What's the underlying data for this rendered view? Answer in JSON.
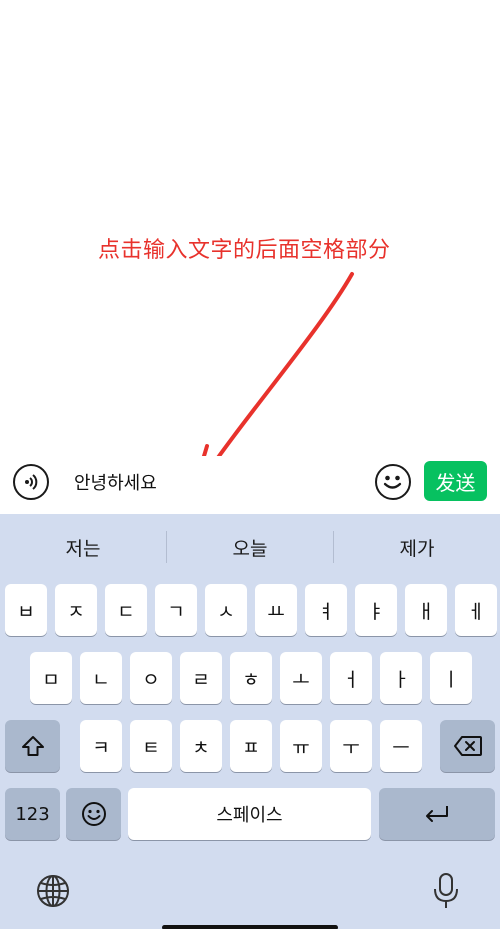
{
  "annotation": {
    "text": "点击输入文字的后面空格部分",
    "color": "#e8322c"
  },
  "input_bar": {
    "voice_icon": "voice-icon",
    "text_value": "안녕하세요",
    "emoji_icon": "emoji-icon",
    "send_label": "发送",
    "send_color": "#07c160"
  },
  "keyboard": {
    "suggestions": [
      "저는",
      "오늘",
      "제가"
    ],
    "row1": [
      "ㅂ",
      "ㅈ",
      "ㄷ",
      "ㄱ",
      "ㅅ",
      "ㅛ",
      "ㅕ",
      "ㅑ",
      "ㅐ",
      "ㅔ"
    ],
    "row2": [
      "ㅁ",
      "ㄴ",
      "ㅇ",
      "ㄹ",
      "ㅎ",
      "ㅗ",
      "ㅓ",
      "ㅏ",
      "ㅣ"
    ],
    "row3": [
      "ㅋ",
      "ㅌ",
      "ㅊ",
      "ㅍ",
      "ㅠ",
      "ㅜ",
      "ㅡ"
    ],
    "numbers_label": "123",
    "space_label": "스페이스",
    "shift_icon": "shift-icon",
    "backspace_icon": "backspace-icon",
    "return_icon": "return-icon",
    "globe_icon": "globe-icon",
    "mic_icon": "microphone-icon",
    "bg_color": "#d2dcef"
  }
}
